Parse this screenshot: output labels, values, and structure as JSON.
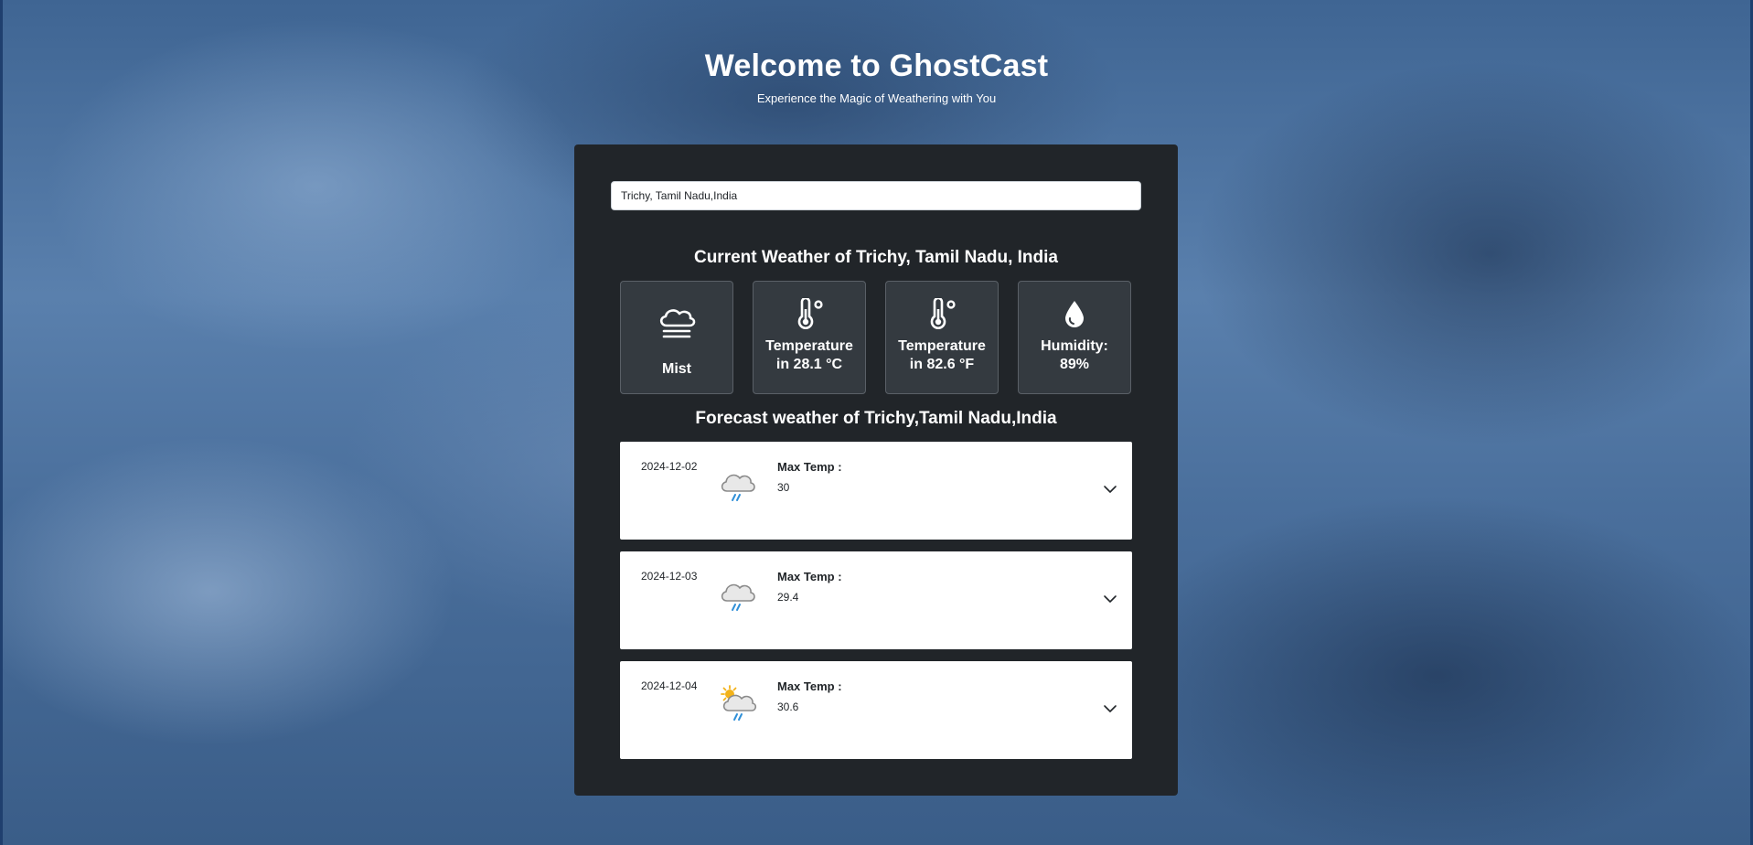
{
  "hero": {
    "title": "Welcome to GhostCast",
    "subtitle": "Experience the Magic of Weathering with You"
  },
  "search": {
    "value": "Trichy, Tamil Nadu,India"
  },
  "current": {
    "title": "Current Weather of Trichy, Tamil Nadu, India",
    "cards": [
      {
        "icon": "cloud-fog-icon",
        "line1": "Mist",
        "line2": ""
      },
      {
        "icon": "thermometer-icon",
        "line1": "Temperature",
        "line2": "in 28.1 °C"
      },
      {
        "icon": "thermometer-icon",
        "line1": "Temperature",
        "line2": "in 82.6 °F"
      },
      {
        "icon": "water-drop-icon",
        "line1": "Humidity:",
        "line2": "89%"
      }
    ]
  },
  "forecast": {
    "title": "Forecast weather of Trichy,Tamil Nadu,India",
    "max_label": "Max Temp :",
    "days": [
      {
        "date": "2024-12-02",
        "icon": "rain-cloud-icon",
        "max_temp": "30"
      },
      {
        "date": "2024-12-03",
        "icon": "rain-cloud-icon",
        "max_temp": "29.4"
      },
      {
        "date": "2024-12-04",
        "icon": "sun-rain-cloud-icon",
        "max_temp": "30.6"
      }
    ]
  },
  "colors": {
    "panel": "#212529",
    "card": "#343a40",
    "text_light": "#ffffff",
    "rain": "#2f8fd8",
    "sun": "#f2b21a"
  }
}
